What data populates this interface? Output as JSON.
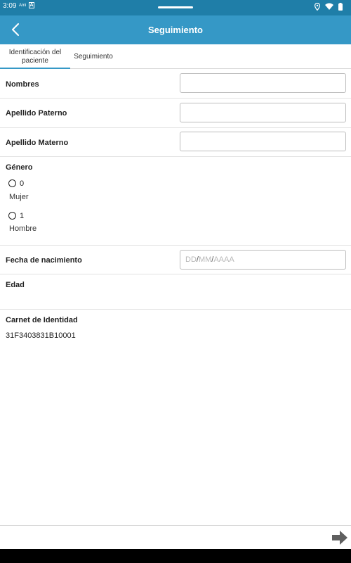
{
  "status_bar": {
    "time": "3:09",
    "small_label": "Ami",
    "a_badge": "A"
  },
  "app_bar": {
    "title": "Seguimiento"
  },
  "tabs": [
    {
      "label": "Identificación del paciente",
      "active": true
    },
    {
      "label": "Seguimiento",
      "active": false
    }
  ],
  "form": {
    "nombres": {
      "label": "Nombres",
      "value": ""
    },
    "apellido_paterno": {
      "label": "Apellido Paterno",
      "value": ""
    },
    "apellido_materno": {
      "label": "Apellido Materno",
      "value": ""
    },
    "genero": {
      "label": "Género",
      "options": [
        {
          "value": "0",
          "name": "Mujer",
          "selected": false
        },
        {
          "value": "1",
          "name": "Hombre",
          "selected": false
        }
      ]
    },
    "fecha_nacimiento": {
      "label": "Fecha de nacimiento",
      "day_placeholder": "DD",
      "month_placeholder": "MM",
      "year_placeholder": "AAAA",
      "separator": "/"
    },
    "edad": {
      "label": "Edad",
      "value": ""
    },
    "carnet": {
      "label": "Carnet de Identidad",
      "value": "31F3403831B10001"
    }
  },
  "colors": {
    "app_bar": "#3598c6",
    "status_bar": "#1f7ea8",
    "tab_indicator": "#3598c6"
  },
  "icons": {
    "back": "chevron-left-icon",
    "next": "arrow-right-icon"
  }
}
